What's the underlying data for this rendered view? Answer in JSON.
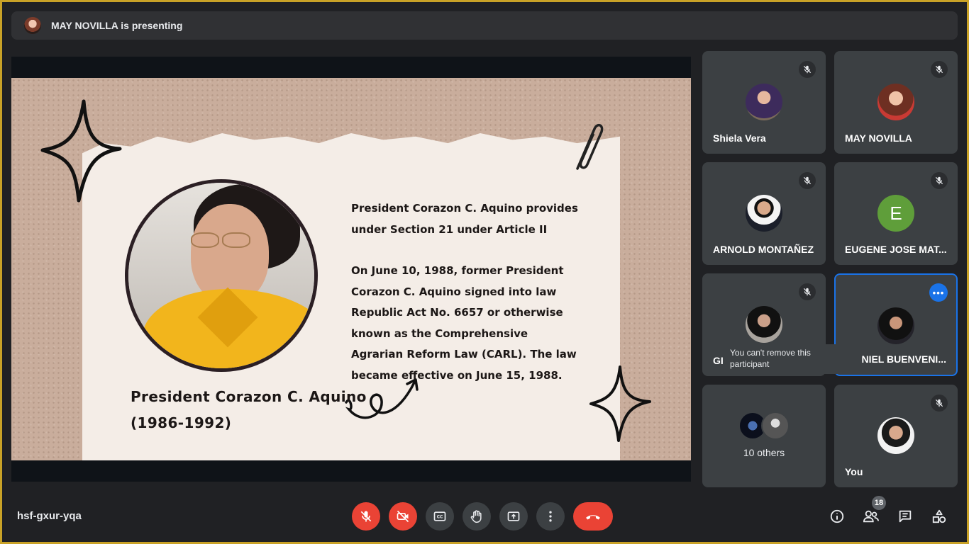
{
  "banner": {
    "presenting_text": "MAY NOVILLA is presenting"
  },
  "slide": {
    "caption_line1": "President Corazon C. Aquino",
    "caption_line2": "(1986-1992)",
    "paragraph1": "President Corazon C. Aquino provides under Section 21 under Article II",
    "paragraph2": "On June 10, 1988, former President Corazon C. Aquino signed into law Republic Act No. 6657 or otherwise known as the Comprehensive Agrarian Reform Law (CARL). The law became effective on June 15, 1988."
  },
  "participants": [
    {
      "name": "Shiela Vera",
      "muted": true
    },
    {
      "name": "MAY NOVILLA",
      "muted": true
    },
    {
      "name": "ARNOLD MONTAÑEZ",
      "muted": true
    },
    {
      "name": "EUGENE JOSE MAT...",
      "muted": true,
      "initial": "E",
      "color": "#5f9e3a"
    },
    {
      "name": "GI",
      "muted": true
    },
    {
      "name": "NIEL BUENVENI...",
      "muted": false,
      "active": true
    }
  ],
  "others": {
    "label": "10 others"
  },
  "self_tile": {
    "name": "You",
    "muted": true
  },
  "tooltip": {
    "text": "You can't remove this participant"
  },
  "bottom_bar": {
    "meeting_code": "hsf-gxur-yqa",
    "people_count": "18",
    "icons": [
      "mic-off-icon",
      "camera-off-icon",
      "captions-icon",
      "raise-hand-icon",
      "present-icon",
      "more-options-icon",
      "end-call-icon",
      "info-icon",
      "people-icon",
      "chat-icon",
      "activities-icon"
    ]
  },
  "colors": {
    "accent": "#1a73e8",
    "danger": "#ea4335",
    "tile": "#3c4043",
    "background": "#202124"
  }
}
